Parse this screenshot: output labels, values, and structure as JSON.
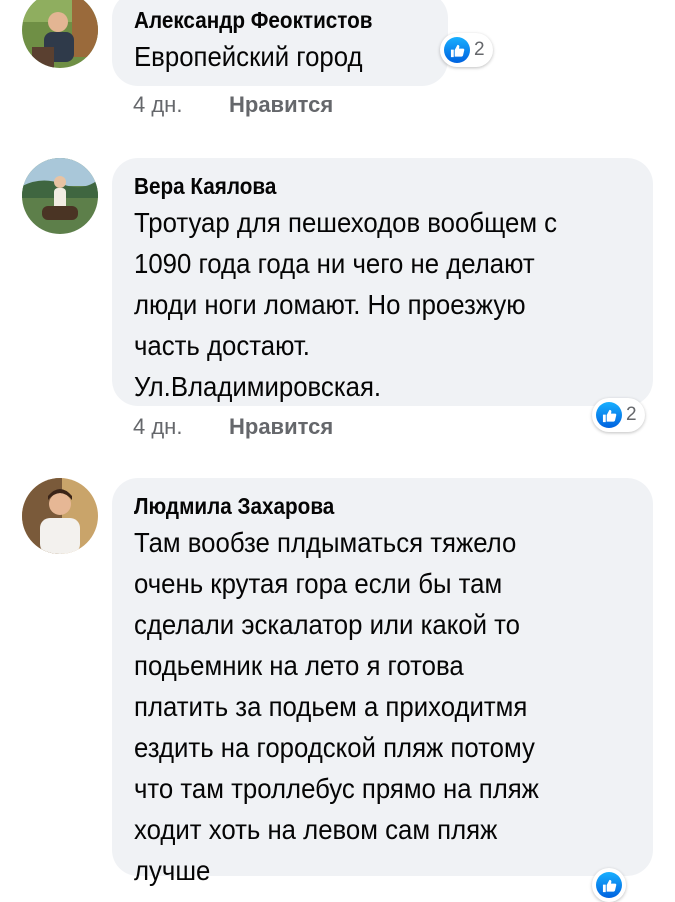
{
  "comments": [
    {
      "author": "Александр Феоктистов",
      "lines": [
        "Европейский город"
      ],
      "time": "4 дн.",
      "like_label": "Нравится",
      "reaction_icon": "like-icon",
      "reaction_count": "2"
    },
    {
      "author": "Вера Каялова",
      "lines": [
        "Тротуар для пешеходов вообщем с",
        "1090 года года ни чего  не делают",
        "люди ноги ломают. Но проезжую",
        "часть достают.",
        "Ул.Владимировская."
      ],
      "time": "4 дн.",
      "like_label": "Нравится",
      "reaction_icon": "like-icon",
      "reaction_count": "2"
    },
    {
      "author": "Людмила Захарова",
      "lines": [
        "Там вообзе плдыматься тяжело",
        "очень крутая гора если бы там",
        "сделали эскалатор или какой то",
        "подьемник на лето я готова",
        "платить за подьем а приходитмя",
        "ездить на городской пляж потому",
        "что там троллебус прямо на пляж",
        "ходит хоть на левом сам пляж",
        "лучше"
      ],
      "reaction_icon": "like-icon"
    }
  ],
  "colors": {
    "bubble": "#f0f2f5",
    "meta_text": "#65676b",
    "like_blue": "#1877f2"
  }
}
